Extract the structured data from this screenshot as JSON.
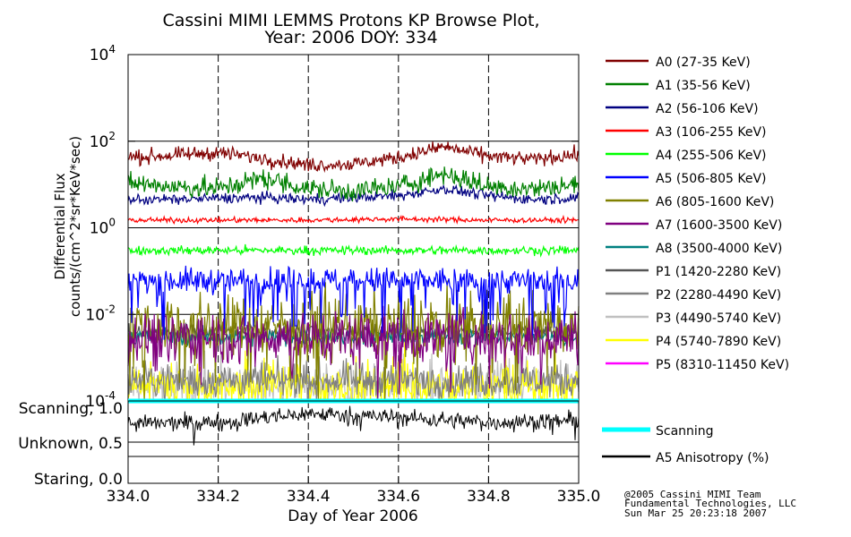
{
  "title": {
    "line1": "Cassini MIMI LEMMS Protons KP Browse Plot,",
    "line2": "Year: 2006 DOY: 334"
  },
  "footer": {
    "line1": "@2005 Cassini MIMI Team",
    "line2": "Fundamental Technologies, LLC",
    "line3": "Sun Mar 25 20:23:18 2007"
  },
  "chart_data": [
    {
      "type": "line",
      "ylabel_line1": "Differential Flux",
      "ylabel_line2": "counts/(cm^2*sr*KeV*sec)",
      "yscale": "log",
      "ylim": [
        0.0001,
        10000
      ],
      "yticks": [
        {
          "base": "10",
          "exp": "4",
          "value": 10000
        },
        {
          "base": "10",
          "exp": "2",
          "value": 100
        },
        {
          "base": "10",
          "exp": "0",
          "value": 1
        },
        {
          "base": "10",
          "exp": "-2",
          "value": 0.01
        },
        {
          "base": "10",
          "exp": "-4",
          "value": 0.0001
        }
      ],
      "xlim": [
        334.0,
        335.0
      ],
      "grid": "dashed vertical lines at 334.2, 334.4, 334.6, 334.8; solid horizontal lines at each labeled decade",
      "legend_position": "right",
      "series": [
        {
          "name": "A0 (27-35 KeV)",
          "color": "#800000",
          "typical_value": 40,
          "spread": 0.08,
          "x": [
            334.0,
            334.1,
            334.2,
            334.3,
            334.4,
            334.5,
            334.6,
            334.7,
            334.8,
            334.9,
            335.0
          ],
          "values": [
            42,
            47,
            55,
            40,
            28,
            30,
            42,
            75,
            45,
            38,
            50
          ]
        },
        {
          "name": "A1 (35-56 KeV)",
          "color": "#008000",
          "typical_value": 10,
          "spread": 0.12,
          "x": [
            334.0,
            334.1,
            334.2,
            334.3,
            334.4,
            334.5,
            334.6,
            334.7,
            334.8,
            334.9,
            335.0
          ],
          "values": [
            11,
            9,
            8,
            14,
            8,
            7,
            9,
            18,
            9,
            8,
            10
          ]
        },
        {
          "name": "A2 (56-106 KeV)",
          "color": "#000080",
          "typical_value": 4.5,
          "spread": 0.06,
          "x": [
            334.0,
            334.1,
            334.2,
            334.3,
            334.4,
            334.5,
            334.6,
            334.7,
            334.8,
            334.9,
            335.0
          ],
          "values": [
            4.5,
            4.5,
            4.8,
            5,
            4.5,
            5,
            5.5,
            8,
            5.5,
            4.5,
            5
          ]
        },
        {
          "name": "A3 (106-255 KeV)",
          "color": "#ff0000",
          "typical_value": 1.5,
          "spread": 0.03,
          "x": [
            334.0,
            334.2,
            334.4,
            334.6,
            334.8,
            335.0
          ],
          "values": [
            1.5,
            1.5,
            1.5,
            1.6,
            1.5,
            1.5
          ]
        },
        {
          "name": "A4 (255-506 KeV)",
          "color": "#00ff00",
          "typical_value": 0.3,
          "spread": 0.05,
          "x": [
            334.0,
            334.2,
            334.4,
            334.6,
            334.8,
            335.0
          ],
          "values": [
            0.3,
            0.3,
            0.3,
            0.3,
            0.3,
            0.3
          ]
        },
        {
          "name": "A5 (506-805 KeV)",
          "color": "#0000ff",
          "typical_value": 0.06,
          "spread": 0.15,
          "x": [
            334.0,
            334.2,
            334.4,
            334.6,
            334.8,
            335.0
          ],
          "values": [
            0.06,
            0.06,
            0.06,
            0.06,
            0.06,
            0.06
          ]
        },
        {
          "name": "A6 (805-1600 KeV)",
          "color": "#808000",
          "typical_value": 0.006,
          "spread": 0.35,
          "x": [
            334.0,
            334.2,
            334.4,
            334.6,
            334.8,
            335.0
          ],
          "values": [
            0.006,
            0.006,
            0.006,
            0.006,
            0.006,
            0.006
          ]
        },
        {
          "name": "A7 (1600-3500 KeV)",
          "color": "#800080",
          "typical_value": 0.003,
          "spread": 0.3,
          "x": [
            334.0,
            334.2,
            334.4,
            334.6,
            334.8,
            335.0
          ],
          "values": [
            0.003,
            0.003,
            0.003,
            0.003,
            0.003,
            0.003
          ]
        },
        {
          "name": "A8 (3500-4000 KeV)",
          "color": "#008080",
          "typical_value": 0.003,
          "spread": 0.1,
          "x": [
            334.0,
            334.2,
            334.4,
            334.6,
            334.8,
            335.0
          ],
          "values": [
            0.003,
            0.003,
            0.003,
            0.003,
            0.003,
            0.003
          ]
        },
        {
          "name": "P1 (1420-2280 KeV)",
          "color": "#555555",
          "typical_value": 0.004,
          "spread": 0.1,
          "x": [
            334.0,
            334.2,
            334.4,
            334.6,
            334.8,
            335.0
          ],
          "values": [
            0.004,
            0.004,
            0.004,
            0.004,
            0.004,
            0.004
          ]
        },
        {
          "name": "P2 (2280-4490 KeV)",
          "color": "#808080",
          "typical_value": 0.0003,
          "spread": 0.2,
          "x": [
            334.0,
            334.2,
            334.4,
            334.6,
            334.8,
            335.0
          ],
          "values": [
            0.0003,
            0.0003,
            0.0003,
            0.0003,
            0.0003,
            0.0003
          ]
        },
        {
          "name": "P3 (4490-5740 KeV)",
          "color": "#c0c0c0",
          "typical_value": 0.0002,
          "spread": 0.2,
          "x": [
            334.0,
            334.2,
            334.4,
            334.6,
            334.8,
            335.0
          ],
          "values": [
            0.0002,
            0.0002,
            0.0002,
            0.0002,
            0.0002,
            0.0002
          ]
        },
        {
          "name": "P4 (5740-7890 KeV)",
          "color": "#ffff00",
          "typical_value": 0.0002,
          "spread": 0.25,
          "x": [
            334.0,
            334.2,
            334.4,
            334.6,
            334.8,
            335.0
          ],
          "values": [
            0.0002,
            0.0002,
            0.0002,
            0.0002,
            0.0002,
            0.0002
          ]
        },
        {
          "name": "P5 (8310-11450 KeV)",
          "color": "#ff00ff",
          "typical_value": null,
          "spread": 0,
          "x": [],
          "values": []
        }
      ]
    },
    {
      "type": "line",
      "yticks": [
        {
          "label": "Scanning, 1.0",
          "value": 1.0
        },
        {
          "label": "Unknown, 0.5",
          "value": 0.5
        },
        {
          "label": "Staring, 0.0",
          "value": 0.0
        }
      ],
      "ylim": [
        0.0,
        1.0
      ],
      "xlim": [
        334.0,
        335.0
      ],
      "xlabel": "Day of Year 2006",
      "xticks": [
        "334.0",
        "334.2",
        "334.4",
        "334.6",
        "334.8",
        "335.0"
      ],
      "xtick_values": [
        334.0,
        334.2,
        334.4,
        334.6,
        334.8,
        335.0
      ],
      "series": [
        {
          "name": "Scanning",
          "color": "#00ffff",
          "x": [
            334.0,
            335.0
          ],
          "values": [
            1.0,
            1.0
          ]
        },
        {
          "name": "A5 Anisotropy (%)",
          "color": "#000000",
          "typical_value": 0.75,
          "spread": 0.05,
          "x": [
            334.0,
            334.2,
            334.4,
            334.6,
            334.8,
            335.0
          ],
          "values": [
            0.72,
            0.74,
            0.85,
            0.8,
            0.74,
            0.76
          ]
        }
      ]
    }
  ]
}
